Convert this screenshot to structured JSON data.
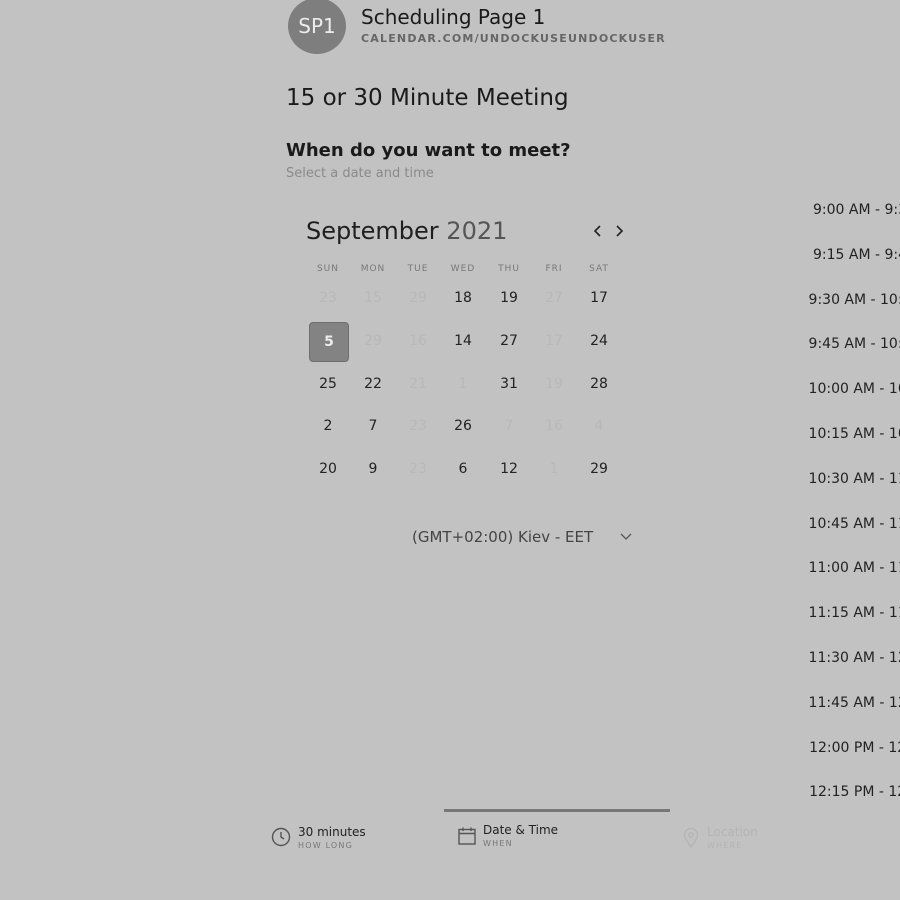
{
  "header": {
    "avatar_initials": "SP1",
    "scheduling_title": "Scheduling Page 1",
    "url": "CALENDAR.COM/UNDOCKUSEUNDOCKUSER"
  },
  "event": {
    "title": "15 or 30 Minute Meeting"
  },
  "question": {
    "title": "When do you want to meet?",
    "subtitle": "Select a date and time"
  },
  "calendar": {
    "month": "September",
    "year": "2021",
    "prev_icon": "chevron-left-icon",
    "next_icon": "chevron-right-icon",
    "weekdays": [
      "SUN",
      "MON",
      "TUE",
      "WED",
      "THU",
      "FRI",
      "SAT"
    ],
    "weeks": [
      [
        {
          "d": "23",
          "off": true
        },
        {
          "d": "15",
          "off": true
        },
        {
          "d": "29",
          "off": true
        },
        {
          "d": "18",
          "off": false
        },
        {
          "d": "19",
          "off": false
        },
        {
          "d": "27",
          "off": true
        },
        {
          "d": "17",
          "off": false
        }
      ],
      [
        {
          "d": "5",
          "off": false,
          "selected": true
        },
        {
          "d": "29",
          "off": true
        },
        {
          "d": "16",
          "off": true
        },
        {
          "d": "14",
          "off": false
        },
        {
          "d": "27",
          "off": false
        },
        {
          "d": "17",
          "off": true
        },
        {
          "d": "24",
          "off": false
        }
      ],
      [
        {
          "d": "25",
          "off": false
        },
        {
          "d": "22",
          "off": false
        },
        {
          "d": "21",
          "off": true
        },
        {
          "d": "1",
          "off": true
        },
        {
          "d": "31",
          "off": false
        },
        {
          "d": "19",
          "off": true
        },
        {
          "d": "28",
          "off": false
        }
      ],
      [
        {
          "d": "2",
          "off": false
        },
        {
          "d": "7",
          "off": false
        },
        {
          "d": "23",
          "off": true
        },
        {
          "d": "26",
          "off": false
        },
        {
          "d": "7",
          "off": true
        },
        {
          "d": "16",
          "off": true
        },
        {
          "d": "4",
          "off": true
        }
      ],
      [
        {
          "d": "20",
          "off": false
        },
        {
          "d": "9",
          "off": false
        },
        {
          "d": "23",
          "off": true
        },
        {
          "d": "6",
          "off": false
        },
        {
          "d": "12",
          "off": false
        },
        {
          "d": "1",
          "off": true
        },
        {
          "d": "29",
          "off": false
        }
      ]
    ]
  },
  "timezone": {
    "label": "(GMT+02:00) Kiev - EET",
    "icon": "chevron-down-icon"
  },
  "time_slots": [
    "9:00 AM - 9:3",
    "9:15 AM - 9:4",
    "9:30 AM - 10:0",
    "9:45 AM - 10:1",
    "10:00 AM - 10:",
    "10:15 AM - 10:",
    "10:30 AM - 11:",
    "10:45 AM - 11:",
    "11:00 AM - 11:",
    "11:15 AM - 11:",
    "11:30 AM - 12:",
    "11:45 AM - 12:",
    "12:00 PM - 12:",
    "12:15 PM - 12:"
  ],
  "tabs": [
    {
      "label": "30 minutes",
      "sub": "HOW LONG",
      "icon": "clock-icon"
    },
    {
      "label": "Date & Time",
      "sub": "WHEN",
      "icon": "calendar-icon"
    },
    {
      "label": "Location",
      "sub": "WHERE",
      "icon": "location-pin-icon"
    }
  ],
  "colors": {
    "background": "#c2c2c2",
    "selected_day": "#838383",
    "active_tab": "#777777"
  }
}
